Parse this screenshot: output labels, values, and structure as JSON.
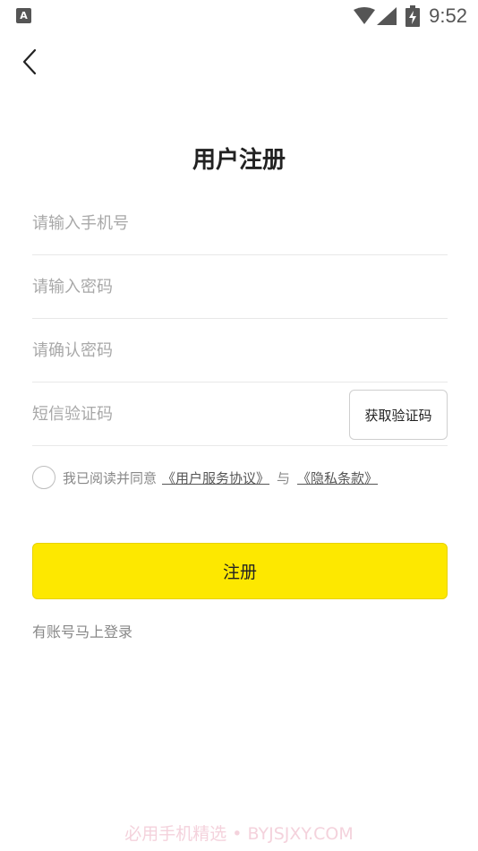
{
  "status_bar": {
    "app_icon_letter": "A",
    "time": "9:52"
  },
  "page": {
    "title": "用户注册"
  },
  "form": {
    "phone_placeholder": "请输入手机号",
    "password_placeholder": "请输入密码",
    "confirm_placeholder": "请确认密码",
    "code_placeholder": "短信验证码",
    "get_code_label": "获取验证码"
  },
  "agreement": {
    "checked": false,
    "prefix": "我已阅读并同意",
    "service_link": "《用户服务协议》",
    "and_text": "与",
    "privacy_link": "《隐私条款》"
  },
  "actions": {
    "register_label": "注册",
    "login_link": "有账号马上登录"
  },
  "watermark": "必用手机精选 • BYJSJXY.COM",
  "colors": {
    "primary_button": "#fde800",
    "placeholder": "#a8a8a8",
    "divider": "#e8e8e8"
  }
}
